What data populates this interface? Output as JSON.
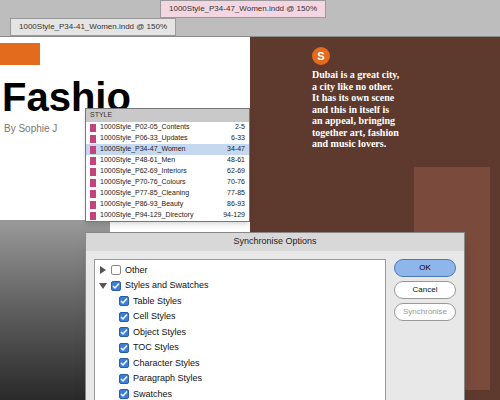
{
  "app_tabs": [
    {
      "label": "1000Style_P34-47_Women.indd @ 150%",
      "selected": true
    },
    {
      "label": "1000Style_P34-41_Women.indd @ 150%",
      "selected": false
    }
  ],
  "document": {
    "heading": "Fashio",
    "byline": "By Sophie J",
    "logo": "S",
    "quote": "Dubai is a great city, a city like no other. It has its own scene and this in itself is an appeal, bringing together art, fashion and music lovers."
  },
  "book_panel": {
    "title": "STYLE",
    "rows": [
      {
        "name": "1000Style_P02-05_Contents",
        "pages": "2-5",
        "selected": false
      },
      {
        "name": "1000Style_P06-33_Updates",
        "pages": "6-33",
        "selected": false
      },
      {
        "name": "1000Style_P34-47_Women",
        "pages": "34-47",
        "selected": true
      },
      {
        "name": "1000Style_P48-61_Men",
        "pages": "48-61",
        "selected": false
      },
      {
        "name": "1000Style_P62-69_Interiors",
        "pages": "62-69",
        "selected": false
      },
      {
        "name": "1000Style_P70-76_Colours",
        "pages": "70-76",
        "selected": false
      },
      {
        "name": "1000Style_P77-85_Cleaning",
        "pages": "77-85",
        "selected": false
      },
      {
        "name": "1000Style_P86-93_Beauty",
        "pages": "86-93",
        "selected": false
      },
      {
        "name": "1000Style_P94-129_Directory",
        "pages": "94-129",
        "selected": false
      }
    ]
  },
  "dialog": {
    "title": "Synchronise Options",
    "tree": [
      {
        "label": "Other",
        "expanded": false,
        "checked": false,
        "children": []
      },
      {
        "label": "Styles and Swatches",
        "expanded": true,
        "checked": true,
        "children": [
          {
            "label": "Table Styles",
            "checked": true
          },
          {
            "label": "Cell Styles",
            "checked": true
          },
          {
            "label": "Object Styles",
            "checked": true
          },
          {
            "label": "TOC Styles",
            "checked": true
          },
          {
            "label": "Character Styles",
            "checked": true
          },
          {
            "label": "Paragraph Styles",
            "checked": true
          },
          {
            "label": "Swatches",
            "checked": true
          }
        ]
      }
    ],
    "buttons": [
      {
        "label": "OK",
        "default": true,
        "disabled": false
      },
      {
        "label": "Cancel",
        "default": false,
        "disabled": false
      },
      {
        "label": "Synchronise",
        "default": false,
        "disabled": true
      }
    ]
  }
}
